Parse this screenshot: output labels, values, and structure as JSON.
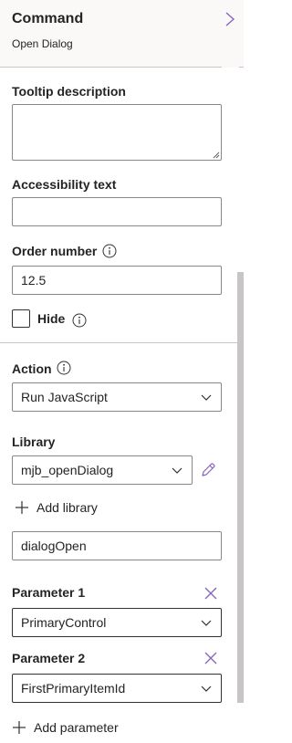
{
  "header": {
    "title": "Command",
    "subtitle": "Open Dialog"
  },
  "tooltip": {
    "label": "Tooltip description",
    "value": ""
  },
  "accessibility": {
    "label": "Accessibility text",
    "value": ""
  },
  "order": {
    "label": "Order number",
    "value": "12.5"
  },
  "hide": {
    "label": "Hide",
    "checked": false
  },
  "action": {
    "label": "Action",
    "selected": "Run JavaScript"
  },
  "library": {
    "label": "Library",
    "selected": "mjb_openDialog",
    "add_label": "Add library"
  },
  "function_name": {
    "value": "dialogOpen"
  },
  "parameter1": {
    "label": "Parameter 1",
    "selected": "PrimaryControl"
  },
  "parameter2": {
    "label": "Parameter 2",
    "selected": "FirstPrimaryItemId"
  },
  "add_parameter": {
    "label": "Add parameter"
  },
  "colors": {
    "accent": "#8764b8",
    "border": "#8a8886",
    "header_bg": "#faf9f8"
  }
}
